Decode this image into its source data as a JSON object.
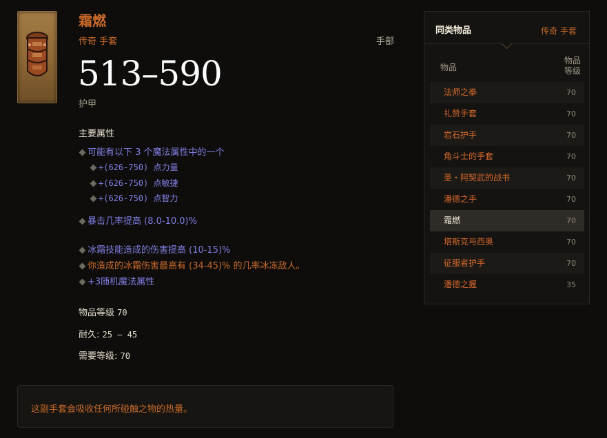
{
  "item": {
    "name": "霜燃",
    "type": "传奇 手套",
    "slot": "手部",
    "armor": "513–590",
    "armor_label": "护甲",
    "primary_title": "主要属性",
    "props": {
      "choice": "可能有以下 3 个魔法属性中的一个",
      "opt1": "+(626-750) 点力量",
      "opt2": "+(626-750) 点敏捷",
      "opt3": "+(626-750) 点智力",
      "crit": "暴击几率提高 (8.0-10.0)%",
      "frost_dmg": "冰霜技能造成的伤害提高 (10-15)%",
      "freeze": "你造成的冰霜伤害最高有 (34-45)% 的几率冰冻敌人。",
      "random": "+3随机魔法属性"
    },
    "stats": {
      "item_level_label": "物品等级",
      "item_level": "70",
      "durability_label": "耐久:",
      "durability": "25 – 45",
      "req_level_label": "需要等级:",
      "req_level": "70"
    },
    "flavor": "这副手套会吸收任何所碰触之物的热量。"
  },
  "panel": {
    "title": "同类物品",
    "filter": "传奇 手套",
    "col_item": "物品",
    "col_level_1": "物品",
    "col_level_2": "等级",
    "rows": [
      {
        "name": "法师之拳",
        "level": "70"
      },
      {
        "name": "礼赞手套",
        "level": "70"
      },
      {
        "name": "岩石护手",
        "level": "70"
      },
      {
        "name": "角斗士的手套",
        "level": "70"
      },
      {
        "name": "圣・阿契武的战书",
        "level": "70"
      },
      {
        "name": "潘德之手",
        "level": "70"
      },
      {
        "name": "霜燃",
        "level": "70"
      },
      {
        "name": "塔斯克与西奥",
        "level": "70"
      },
      {
        "name": "征服者护手",
        "level": "70"
      },
      {
        "name": "潘德之握",
        "level": "35"
      }
    ]
  },
  "colors": {
    "legendary": "#c96a2a",
    "magic": "#7f7fe6"
  },
  "icons": {
    "item_image": "gauntlet-icon"
  }
}
